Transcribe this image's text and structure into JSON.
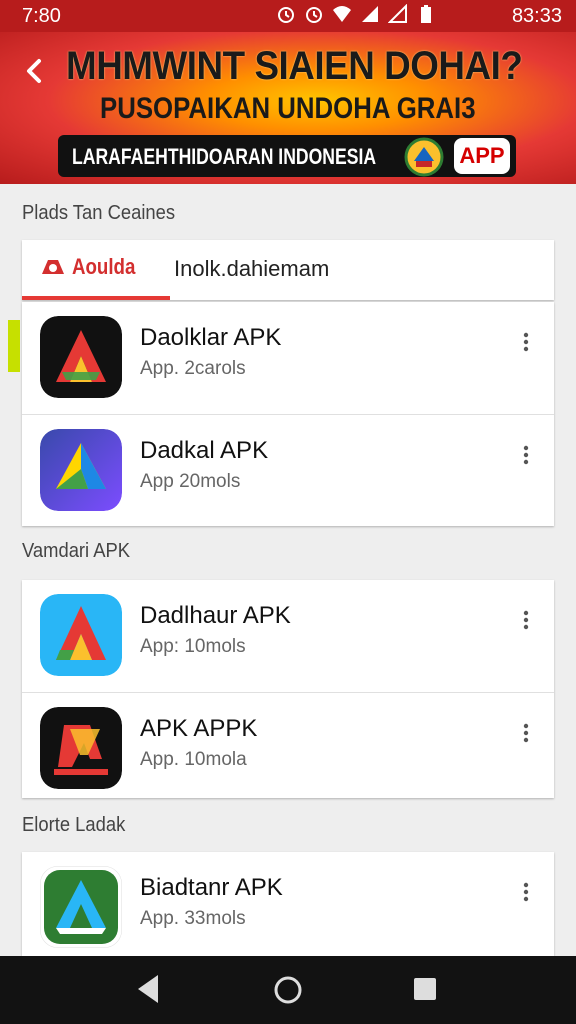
{
  "status_bar": {
    "time": "7:80",
    "right_time": "83:33"
  },
  "banner": {
    "title": "MHMWINT SIAIEN DOHAI?",
    "subtitle": "PUSOPAIKAN UNDOHA GRAI3",
    "strip_text": "LARAFAEHTHIDOARAN INDONESIA",
    "badge": "APP"
  },
  "section1": {
    "label": "Plads Tan Ceaines"
  },
  "tabs": {
    "active": "Aoulda",
    "second": "Inolk.dahiemam"
  },
  "section2": {
    "label": "Vamdari APK"
  },
  "section3": {
    "label": "Elorte Ladak"
  },
  "apps": [
    {
      "name": "Daolklar APK",
      "meta": "App. 2carols",
      "icon": "app-a-black-icon"
    },
    {
      "name": "Dadkal APK",
      "meta": "App 20mols",
      "icon": "app-a-purple-icon"
    },
    {
      "name": "Dadlhaur APK",
      "meta": "App: 10mols",
      "icon": "app-a-blue-icon"
    },
    {
      "name": "APK APPK",
      "meta": "App. 10mola",
      "icon": "app-a-dark-icon"
    },
    {
      "name": "Biadtanr APK",
      "meta": "App. 33mols",
      "icon": "app-a-green-icon"
    }
  ],
  "colors": {
    "accent": "#d32f2f",
    "banner_red": "#b71c1c",
    "tab_indicator": "#e53935"
  }
}
